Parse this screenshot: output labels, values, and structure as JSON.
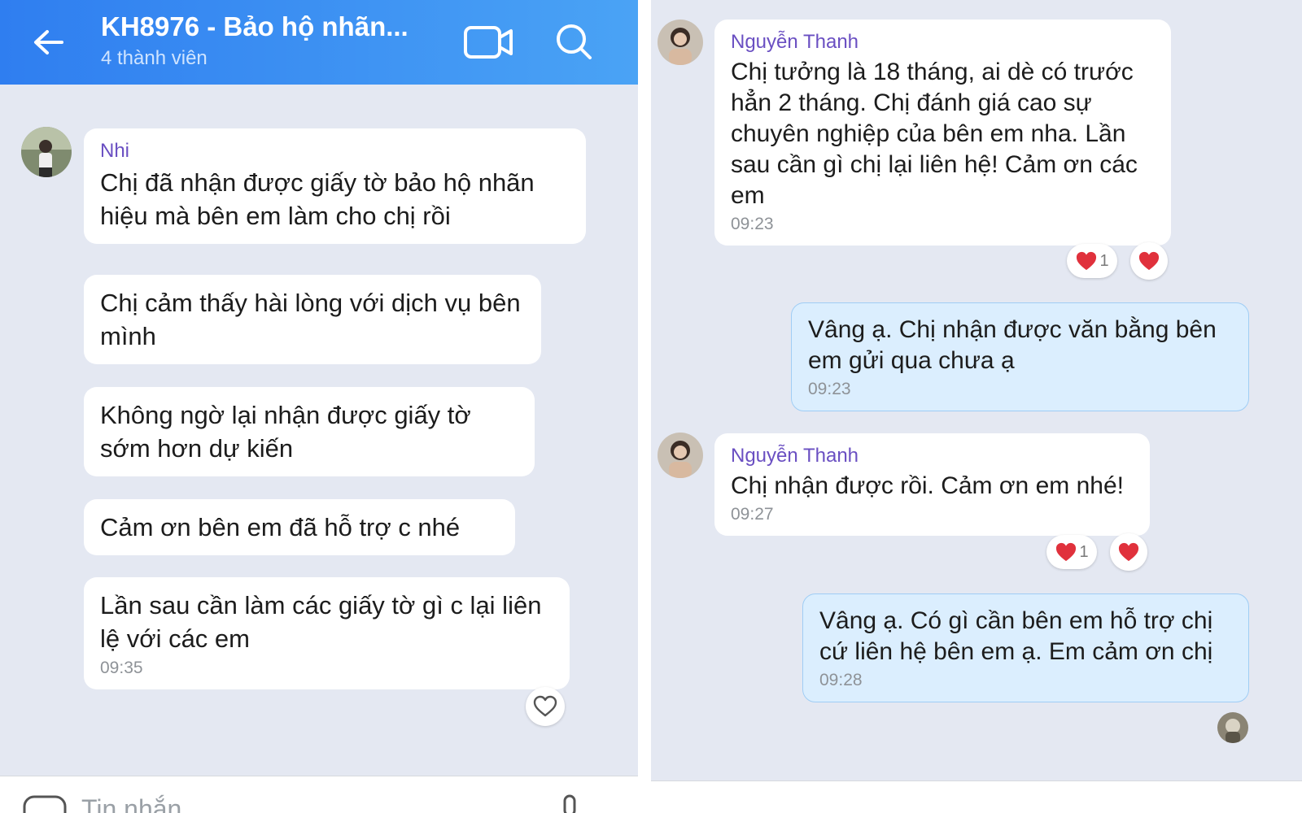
{
  "left": {
    "header": {
      "title": "KH8976 - Bảo hộ nhãn...",
      "subtitle": "4 thành viên"
    },
    "sender_name": "Nhi",
    "messages": [
      {
        "text": "Chị đã nhận được giấy tờ bảo hộ nhãn hiệu mà bên em làm cho chị rồi"
      },
      {
        "text": "Chị cảm thấy hài lòng với dịch vụ bên mình"
      },
      {
        "text": "Không ngờ lại nhận được giấy tờ sớm hơn dự kiến"
      },
      {
        "text": "Cảm ơn bên em đã hỗ trợ c nhé"
      },
      {
        "text": "Lần sau cần làm các giấy tờ gì c lại liên lệ với các em",
        "time": "09:35"
      }
    ],
    "input_placeholder": "Tin nhắn"
  },
  "right": {
    "messages": [
      {
        "sender": "Nguyễn Thanh",
        "text": "Chị tưởng là 18 tháng, ai dè có trước hẳn 2 tháng. Chị đánh giá cao sự chuyên nghiệp của bên em nha. Lần sau cần gì chị lại liên hệ! Cảm ơn các em",
        "time": "09:23",
        "reaction_count": "1"
      },
      {
        "text": "Vâng ạ. Chị nhận được văn bằng bên em gửi qua chưa ạ",
        "time": "09:23"
      },
      {
        "sender": "Nguyễn Thanh",
        "text": "Chị nhận được rồi. Cảm ơn em nhé!",
        "time": "09:27",
        "reaction_count": "1"
      },
      {
        "text": "Vâng ạ. Có gì cần bên em hỗ trợ chị cứ liên hệ bên em ạ. Em cảm ơn chị",
        "time": "09:28"
      }
    ]
  },
  "colors": {
    "header": "#2f7ef0",
    "chat_bg": "#e4e8f2",
    "incoming_bubble": "#ffffff",
    "outgoing_bubble": "#dbeefe",
    "sender_name": "#6a4fc2",
    "heart": "#e0313c"
  },
  "icons": [
    "back-arrow-icon",
    "video-call-icon",
    "search-icon",
    "heart-outline-icon",
    "heart-icon",
    "sticker-icon",
    "microphone-icon"
  ]
}
